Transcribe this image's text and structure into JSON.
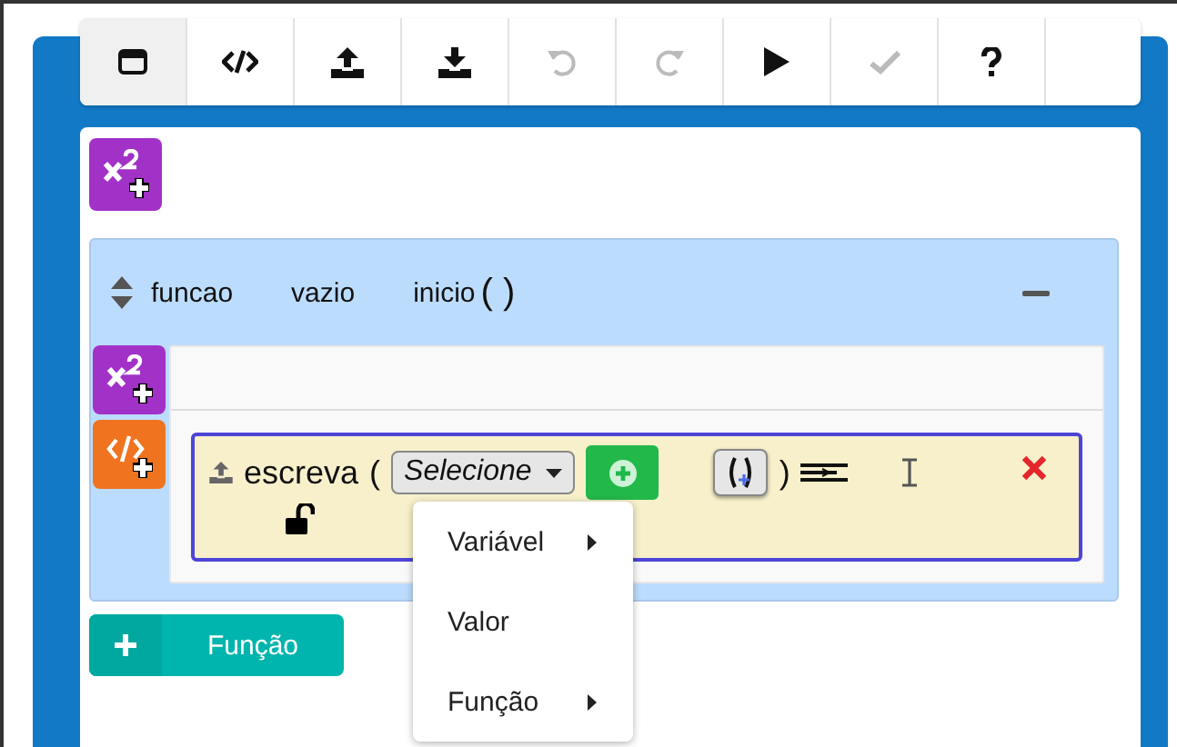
{
  "toolbar": [
    {
      "kind": "window",
      "disabled": false,
      "selected": true
    },
    {
      "kind": "code",
      "disabled": false,
      "selected": false
    },
    {
      "kind": "upload",
      "disabled": false,
      "selected": false
    },
    {
      "kind": "download",
      "disabled": false,
      "selected": false
    },
    {
      "kind": "undo",
      "disabled": true,
      "selected": false
    },
    {
      "kind": "redo",
      "disabled": true,
      "selected": false
    },
    {
      "kind": "play",
      "disabled": false,
      "selected": false
    },
    {
      "kind": "check",
      "disabled": true,
      "selected": false
    },
    {
      "kind": "help",
      "disabled": false,
      "selected": false
    }
  ],
  "function": {
    "type": "funcao",
    "return_type": "vazio",
    "name": "inicio",
    "parens": "( )",
    "statement": {
      "command": "escreva",
      "open_paren": "(",
      "select": "Selecione",
      "close_paren": ")",
      "menu": [
        {
          "label": "Variável",
          "submenu": true
        },
        {
          "label": "Valor",
          "submenu": false
        },
        {
          "label": "Função",
          "submenu": true
        }
      ]
    }
  },
  "add_function": {
    "label": "Função"
  }
}
